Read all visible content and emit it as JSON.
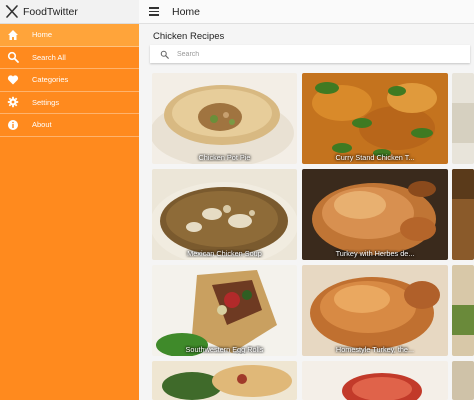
{
  "app": {
    "title": "FoodTwitter",
    "icon": "fork-knife-icon"
  },
  "topbar": {
    "title": "Home",
    "menu_icon": "menu-icon"
  },
  "sidebar": {
    "items": [
      {
        "label": "Home",
        "icon": "home-icon",
        "active": true
      },
      {
        "label": "Search All",
        "icon": "search-icon"
      },
      {
        "label": "Categories",
        "icon": "heart-icon"
      },
      {
        "label": "Settings",
        "icon": "gear-icon"
      },
      {
        "label": "About",
        "icon": "info-icon"
      }
    ]
  },
  "main": {
    "section_title": "Chicken Recipes",
    "search": {
      "placeholder": "Search",
      "value": ""
    },
    "recipes": [
      {
        "title": "Chicken Pot Pie"
      },
      {
        "title": "Curry Stand Chicken T..."
      },
      {
        "title": "Mexican Chicken Soup"
      },
      {
        "title": "Turkey with Herbes de..."
      },
      {
        "title": "Southwestern Egg Rolls"
      },
      {
        "title": "Homestyle Turkey, the..."
      },
      {
        "title": ""
      },
      {
        "title": ""
      }
    ]
  },
  "colors": {
    "sidebar": "#ff8a1e",
    "sidebar_active": "#ffa43a",
    "topbar": "#fafafa"
  }
}
